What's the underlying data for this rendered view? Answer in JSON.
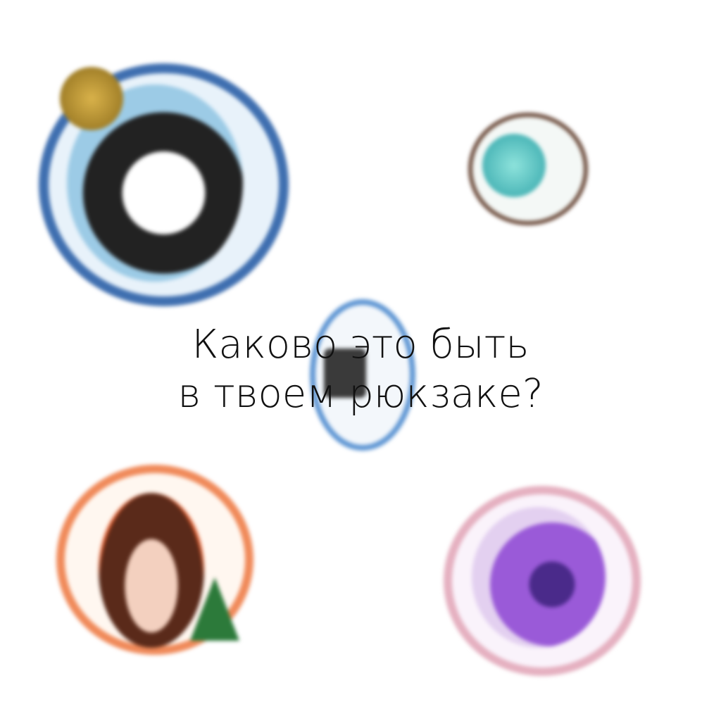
{
  "caption": {
    "line1": "Каково это быть",
    "line2": "в твоем рюкзаке?"
  },
  "avatars": [
    {
      "subject": "husky-dog-avatar",
      "ring_color": "#3f6fb0"
    },
    {
      "subject": "cyan-creature-avatar",
      "ring_color": "#6b4a3a"
    },
    {
      "subject": "grey-item-avatar",
      "ring_color": "#5d95d3"
    },
    {
      "subject": "girl-christmas-avatar",
      "ring_color": "#f08a5a"
    },
    {
      "subject": "purple-dragon-avatar",
      "ring_color": "#e5b0c0"
    }
  ]
}
